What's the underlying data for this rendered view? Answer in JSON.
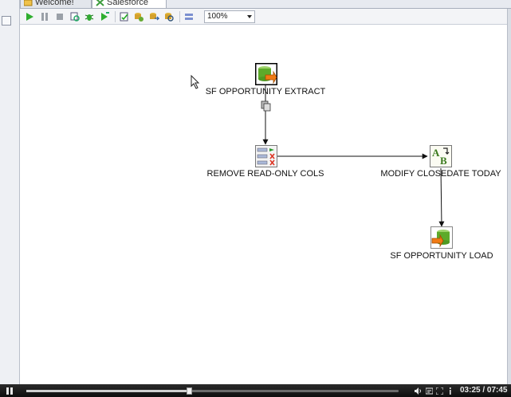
{
  "tabs": [
    {
      "label": "Welcome!",
      "active": false
    },
    {
      "label": "Salesforce",
      "active": true,
      "close": "☒"
    }
  ],
  "toolbar": {
    "zoom": "100%",
    "buttons": [
      "run-icon",
      "pause-icon",
      "stop-icon",
      "preview-icon",
      "debug-icon",
      "replay-icon",
      "verify-icon",
      "impact-icon",
      "sql-icon",
      "explore-db-icon",
      "show-results-icon"
    ]
  },
  "canvas": {
    "steps": [
      {
        "id": "extract",
        "label": "SF OPPORTUNITY EXTRACT",
        "icon": "salesforce-input-icon"
      },
      {
        "id": "remove",
        "label": "REMOVE READ-ONLY COLS",
        "icon": "select-values-icon"
      },
      {
        "id": "modify",
        "label": "MODIFY CLOSEDATE TODAY",
        "icon": "modified-javascript-icon"
      },
      {
        "id": "load",
        "label": "SF OPPORTUNITY LOAD",
        "icon": "salesforce-output-icon"
      }
    ],
    "hops": [
      {
        "from": "extract",
        "to": "remove"
      },
      {
        "from": "remove",
        "to": "modify"
      },
      {
        "from": "modify",
        "to": "load"
      }
    ]
  },
  "player": {
    "time": "03:25 / 07:45",
    "progress": 0.44,
    "colors": {
      "bar": "#1a1a1a",
      "text": "#e8e8e8"
    }
  }
}
